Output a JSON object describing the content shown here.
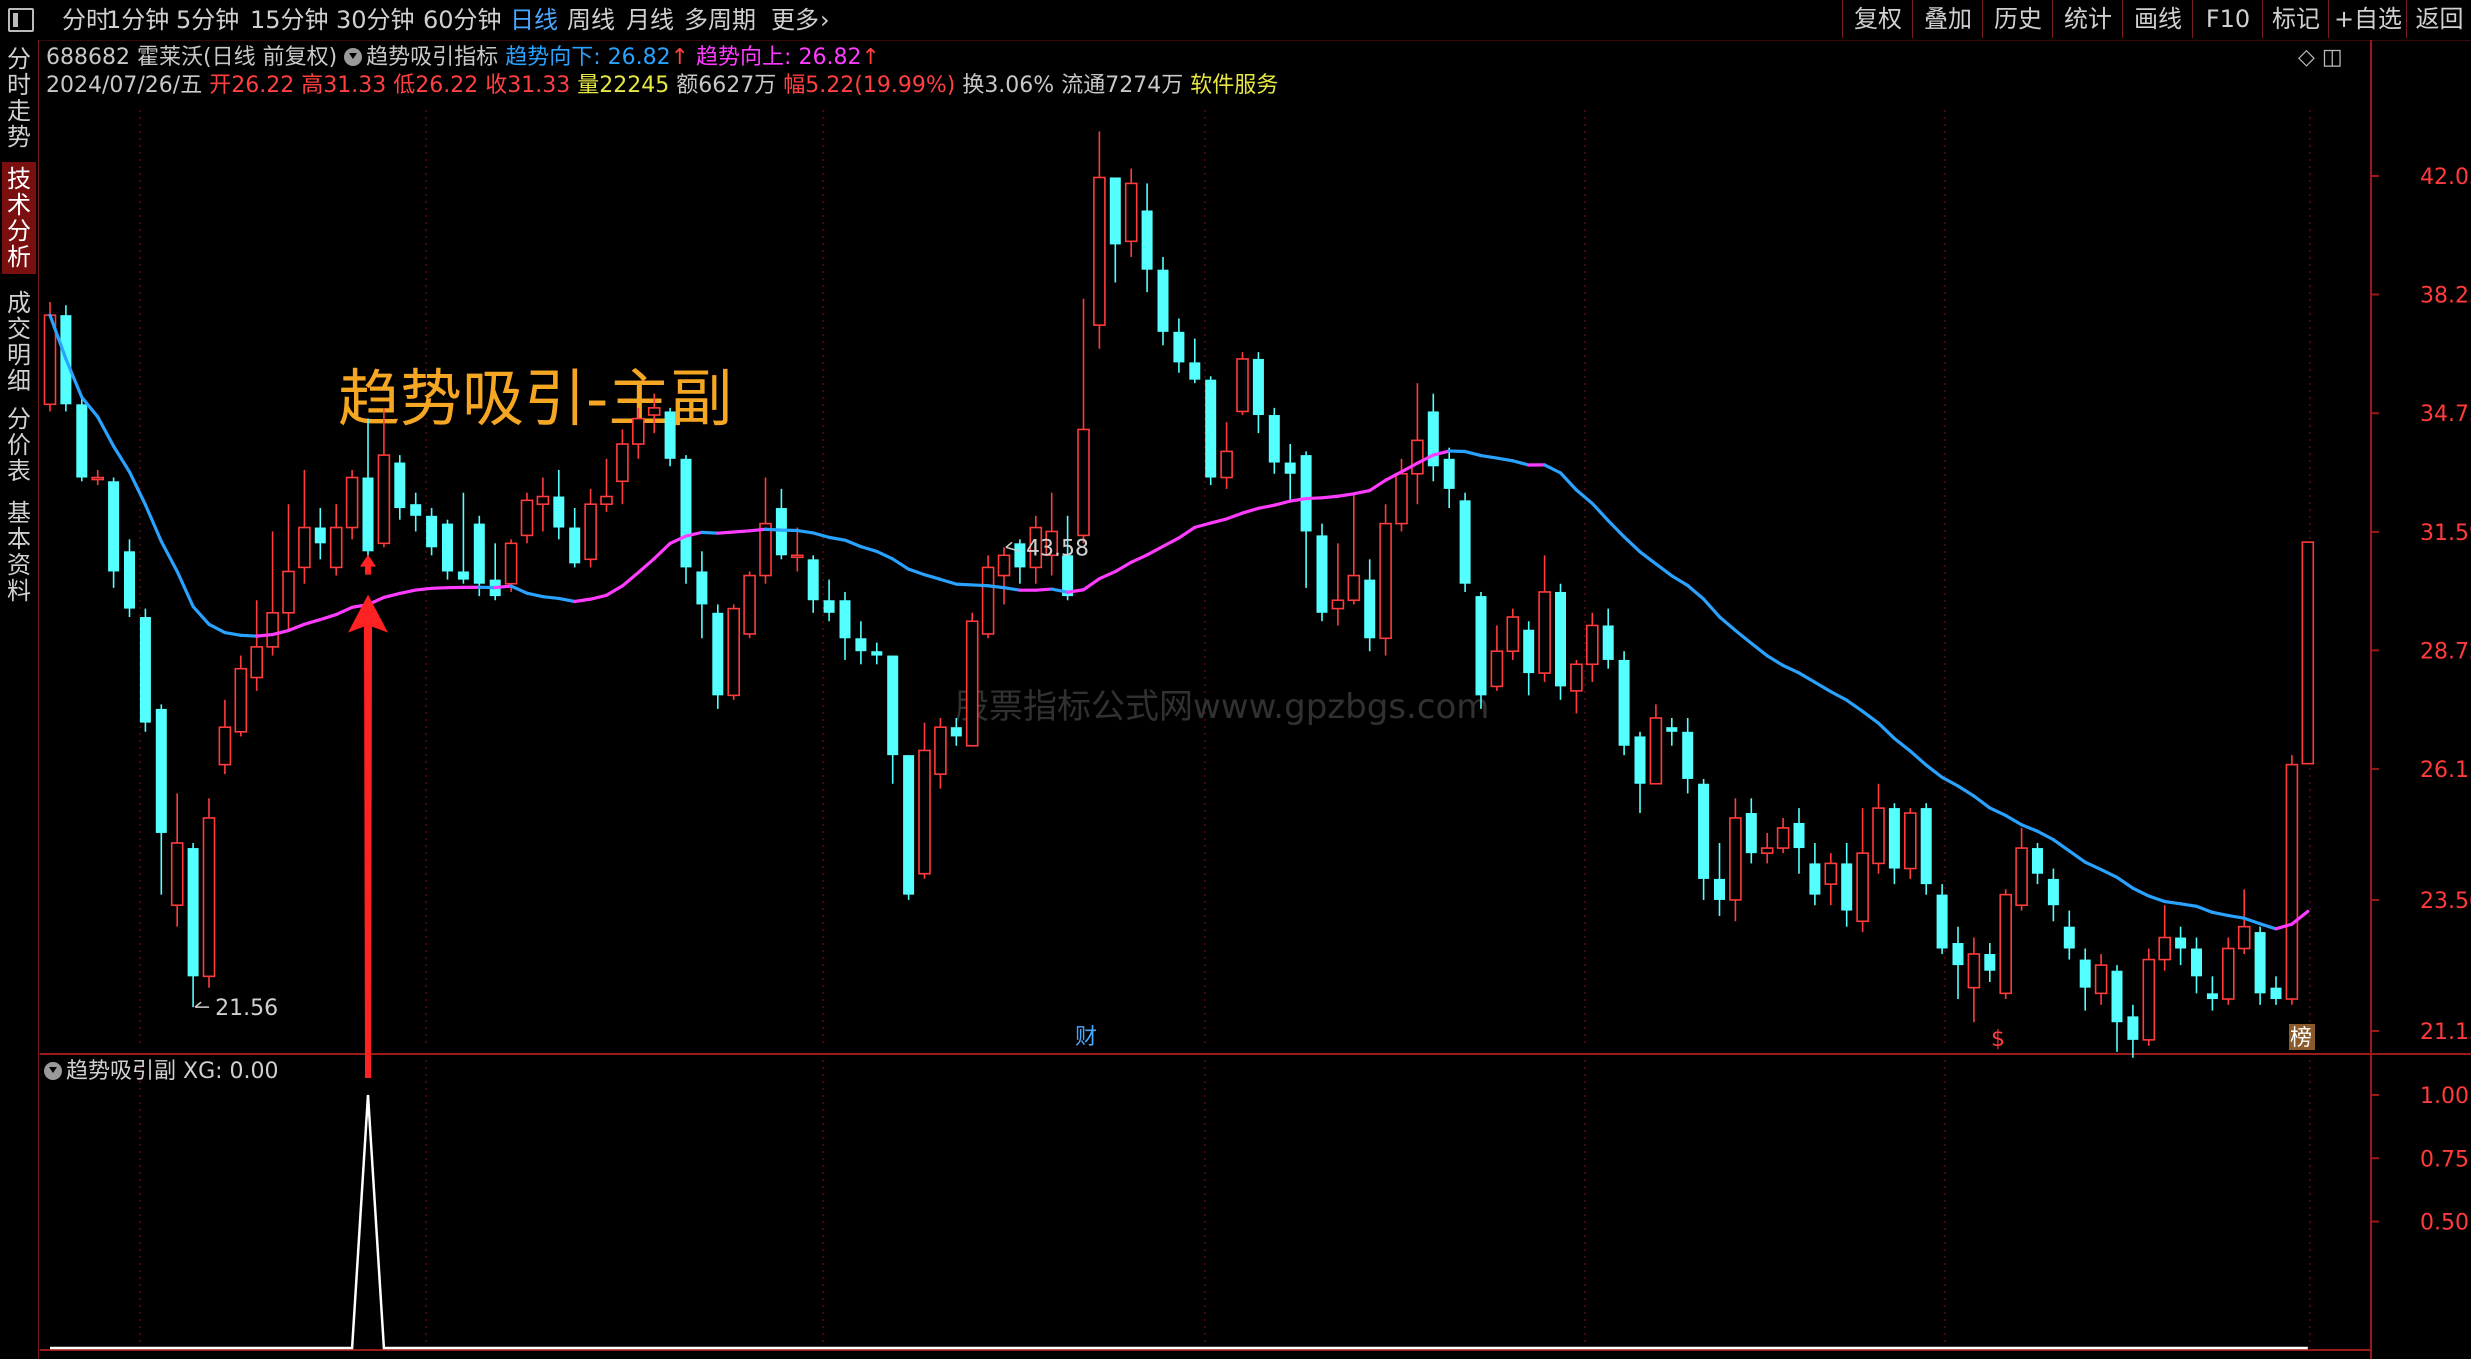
{
  "toolbar": {
    "periods": [
      "分时",
      "1分钟",
      "5分钟",
      "15分钟",
      "30分钟",
      "60分钟",
      "日线",
      "周线",
      "月线",
      "多周期",
      "更多"
    ],
    "active_period": "日线",
    "more_chevron": "chevron-right-icon",
    "right_buttons": [
      "复权",
      "叠加",
      "历史",
      "统计",
      "画线",
      "F10",
      "标记",
      "+自选",
      "返回"
    ]
  },
  "sidebar": {
    "tabs": [
      "分时走势",
      "技术分析",
      "成交明细",
      "分价表",
      "基本资料"
    ],
    "active_tab": "技术分析"
  },
  "header": {
    "code": "688682",
    "name": "霍莱沃",
    "period_note": "(日线 前复权)",
    "indicator_name": "趋势吸引指标",
    "down_label": "趋势向下:",
    "down_value": "26.82",
    "up_label": "趋势向上:",
    "up_value": "26.82",
    "arrow": "↑"
  },
  "quote": {
    "date": "2024/07/26/五",
    "open_label": "开",
    "open": "26.22",
    "high_label": "高",
    "high": "31.33",
    "low_label": "低",
    "low": "26.22",
    "close_label": "收",
    "close": "31.33",
    "vol_label": "量",
    "volume": "22245",
    "amt_label": "额",
    "amount": "6627万",
    "chg_label": "幅",
    "change": "5.22(19.99%)",
    "turnover": "换3.06%",
    "float": "流通7274万",
    "service": "软件服务"
  },
  "overlay_title": "趋势吸引-主副",
  "watermark": "股票指标公式网www.gpzbgs.com",
  "markers": {
    "fin": "财",
    "dollar": "$",
    "rank": "榜"
  },
  "sub_panel": {
    "title": "趋势吸引副",
    "value_text": "XG: 0.00"
  },
  "colors": {
    "up": "#ff3b3b",
    "down": "#54ffff",
    "trend_down": "#2aa2ff",
    "trend_up": "#ff3cff",
    "axis": "#9a1a1a",
    "grid": "#8a1010",
    "title": "#f5a623",
    "signal": "#ff2222"
  },
  "chart_data": {
    "type": "candlestick",
    "y_axis_ticks": [
      42.05,
      38.23,
      34.75,
      31.59,
      28.72,
      26.11,
      23.5,
      21.15
    ],
    "y_scale": "log",
    "annotations": [
      {
        "text": "43.58",
        "candle": 60
      },
      {
        "text": "21.56",
        "candle": 9
      }
    ],
    "candles": [
      [
        35.0,
        37.6,
        38.0,
        34.8
      ],
      [
        37.6,
        35.0,
        37.9,
        34.8
      ],
      [
        35.0,
        33.0,
        35.2,
        32.9
      ],
      [
        33.0,
        33.0,
        33.2,
        32.8
      ],
      [
        32.9,
        30.6,
        33.0,
        30.2
      ],
      [
        31.1,
        29.7,
        31.4,
        29.5
      ],
      [
        29.5,
        27.1,
        29.7,
        26.9
      ],
      [
        27.4,
        24.8,
        27.5,
        23.6
      ],
      [
        23.4,
        24.6,
        25.6,
        23.0
      ],
      [
        24.5,
        22.1,
        24.6,
        21.56
      ],
      [
        22.1,
        25.1,
        25.5,
        21.9
      ],
      [
        26.2,
        27.0,
        27.6,
        26.0
      ],
      [
        26.9,
        28.3,
        28.6,
        26.8
      ],
      [
        28.1,
        28.8,
        29.9,
        27.8
      ],
      [
        28.8,
        29.6,
        31.6,
        28.6
      ],
      [
        29.6,
        30.6,
        32.3,
        29.2
      ],
      [
        30.7,
        31.7,
        33.2,
        30.3
      ],
      [
        31.7,
        31.3,
        32.2,
        30.9
      ],
      [
        30.7,
        31.7,
        32.3,
        30.5
      ],
      [
        31.7,
        33.0,
        33.2,
        31.4
      ],
      [
        33.0,
        31.1,
        34.6,
        30.6
      ],
      [
        31.3,
        33.6,
        34.9,
        31.2
      ],
      [
        33.4,
        32.2,
        33.6,
        31.9
      ],
      [
        32.3,
        32.0,
        32.6,
        31.6
      ],
      [
        32.0,
        31.2,
        32.2,
        31.0
      ],
      [
        31.8,
        30.6,
        31.9,
        30.4
      ],
      [
        30.6,
        30.4,
        32.6,
        30.3
      ],
      [
        31.8,
        30.3,
        32.0,
        30.0
      ],
      [
        30.4,
        30.0,
        31.3,
        29.9
      ],
      [
        30.3,
        31.3,
        31.4,
        30.1
      ],
      [
        31.5,
        32.4,
        32.6,
        31.3
      ],
      [
        32.3,
        32.5,
        33.0,
        31.6
      ],
      [
        32.5,
        31.7,
        33.2,
        31.4
      ],
      [
        31.7,
        30.8,
        32.2,
        30.7
      ],
      [
        30.9,
        32.3,
        32.7,
        30.7
      ],
      [
        32.3,
        32.5,
        33.5,
        32.1
      ],
      [
        32.9,
        33.9,
        34.3,
        32.3
      ],
      [
        33.9,
        34.6,
        34.9,
        33.5
      ],
      [
        34.7,
        34.9,
        35.3,
        34.2
      ],
      [
        34.8,
        33.5,
        34.9,
        33.3
      ],
      [
        33.5,
        30.7,
        33.6,
        30.3
      ],
      [
        30.6,
        29.8,
        31.1,
        29.0
      ],
      [
        29.6,
        27.7,
        29.8,
        27.4
      ],
      [
        27.7,
        29.7,
        29.8,
        27.6
      ],
      [
        29.1,
        30.5,
        30.6,
        29.0
      ],
      [
        30.5,
        31.8,
        33.0,
        30.3
      ],
      [
        32.2,
        31.0,
        32.7,
        30.9
      ],
      [
        31.0,
        31.0,
        31.7,
        30.6
      ],
      [
        30.9,
        29.9,
        31.0,
        29.6
      ],
      [
        29.9,
        29.6,
        30.4,
        29.4
      ],
      [
        29.9,
        29.0,
        30.1,
        28.5
      ],
      [
        29.0,
        28.7,
        29.4,
        28.4
      ],
      [
        28.7,
        28.6,
        28.9,
        28.4
      ],
      [
        28.6,
        26.4,
        28.6,
        25.8
      ],
      [
        26.4,
        23.6,
        26.4,
        23.5
      ],
      [
        24.0,
        26.5,
        27.1,
        23.9
      ],
      [
        26.0,
        27.0,
        27.2,
        25.7
      ],
      [
        27.0,
        26.8,
        27.2,
        26.6
      ],
      [
        26.6,
        29.4,
        29.6,
        26.6
      ],
      [
        29.1,
        30.7,
        31.0,
        29.0
      ],
      [
        30.5,
        31.0,
        31.2,
        29.8
      ],
      [
        31.3,
        30.7,
        31.4,
        30.3
      ],
      [
        30.7,
        31.7,
        32.0,
        30.3
      ],
      [
        31.0,
        31.6,
        32.6,
        30.5
      ],
      [
        31.0,
        30.0,
        32.0,
        29.9
      ],
      [
        31.5,
        34.3,
        38.1,
        31.3
      ],
      [
        37.3,
        42.0,
        43.58,
        36.6
      ],
      [
        42.0,
        39.8,
        42.0,
        38.6
      ],
      [
        39.9,
        41.8,
        42.3,
        39.4
      ],
      [
        40.9,
        39.0,
        41.8,
        38.3
      ],
      [
        39.0,
        37.1,
        39.4,
        36.7
      ],
      [
        37.1,
        36.2,
        37.5,
        35.9
      ],
      [
        36.2,
        35.7,
        36.9,
        35.6
      ],
      [
        35.7,
        33.0,
        35.8,
        32.8
      ],
      [
        33.0,
        33.7,
        34.5,
        32.7
      ],
      [
        34.8,
        36.3,
        36.5,
        34.7
      ],
      [
        36.3,
        34.7,
        36.5,
        34.2
      ],
      [
        34.7,
        33.4,
        34.9,
        33.1
      ],
      [
        33.4,
        33.1,
        33.9,
        32.4
      ],
      [
        33.6,
        31.6,
        33.7,
        30.2
      ],
      [
        31.5,
        29.6,
        31.8,
        29.4
      ],
      [
        29.7,
        29.9,
        31.3,
        29.3
      ],
      [
        29.9,
        30.5,
        32.6,
        29.8
      ],
      [
        30.4,
        29.0,
        30.9,
        28.7
      ],
      [
        29.0,
        31.8,
        32.3,
        28.6
      ],
      [
        31.8,
        33.1,
        33.5,
        31.6
      ],
      [
        33.1,
        34.0,
        35.6,
        32.3
      ],
      [
        34.8,
        33.3,
        35.3,
        32.9
      ],
      [
        33.5,
        32.7,
        33.8,
        32.2
      ],
      [
        32.4,
        30.3,
        32.6,
        30.1
      ],
      [
        30.0,
        27.7,
        30.1,
        27.4
      ],
      [
        27.9,
        28.7,
        29.3,
        27.8
      ],
      [
        28.7,
        29.5,
        29.7,
        28.5
      ],
      [
        29.2,
        28.2,
        29.4,
        27.7
      ],
      [
        28.2,
        30.1,
        31.0,
        28.0
      ],
      [
        30.1,
        27.9,
        30.3,
        27.6
      ],
      [
        27.8,
        28.4,
        28.5,
        27.3
      ],
      [
        28.4,
        29.3,
        29.6,
        28.0
      ],
      [
        29.3,
        28.5,
        29.7,
        28.3
      ],
      [
        28.5,
        26.6,
        28.7,
        26.4
      ],
      [
        26.8,
        25.8,
        26.9,
        25.2
      ],
      [
        25.8,
        27.2,
        27.5,
        25.8
      ],
      [
        27.0,
        26.9,
        27.2,
        26.6
      ],
      [
        26.9,
        25.9,
        27.2,
        25.6
      ],
      [
        25.8,
        23.9,
        25.9,
        23.5
      ],
      [
        23.9,
        23.5,
        24.6,
        23.2
      ],
      [
        23.5,
        25.1,
        25.5,
        23.1
      ],
      [
        25.2,
        24.4,
        25.5,
        24.2
      ],
      [
        24.4,
        24.5,
        24.8,
        24.2
      ],
      [
        24.5,
        24.9,
        25.1,
        24.4
      ],
      [
        25.0,
        24.5,
        25.3,
        24.0
      ],
      [
        24.2,
        23.6,
        24.6,
        23.4
      ],
      [
        23.8,
        24.2,
        24.4,
        23.4
      ],
      [
        24.2,
        23.3,
        24.6,
        23.0
      ],
      [
        23.1,
        24.4,
        25.3,
        22.9
      ],
      [
        24.2,
        25.3,
        25.8,
        24.0
      ],
      [
        25.3,
        24.1,
        25.4,
        23.8
      ],
      [
        24.1,
        25.2,
        25.3,
        23.9
      ],
      [
        25.3,
        23.8,
        25.4,
        23.6
      ],
      [
        23.6,
        22.6,
        23.8,
        22.5
      ],
      [
        22.7,
        22.3,
        23.0,
        21.7
      ],
      [
        21.9,
        22.5,
        22.8,
        21.3
      ],
      [
        22.5,
        22.2,
        22.7,
        22.0
      ],
      [
        21.8,
        23.6,
        23.7,
        21.7
      ],
      [
        23.4,
        24.5,
        24.9,
        23.3
      ],
      [
        24.5,
        24.0,
        24.6,
        23.8
      ],
      [
        23.9,
        23.4,
        24.1,
        23.1
      ],
      [
        23.0,
        22.6,
        23.3,
        22.4
      ],
      [
        22.4,
        21.9,
        22.6,
        21.5
      ],
      [
        21.8,
        22.3,
        22.5,
        21.6
      ],
      [
        22.2,
        21.3,
        22.3,
        20.8
      ],
      [
        21.4,
        21.0,
        21.6,
        20.7
      ],
      [
        21.0,
        22.4,
        22.6,
        20.9
      ],
      [
        22.4,
        22.8,
        23.4,
        22.2
      ],
      [
        22.8,
        22.6,
        23.0,
        22.3
      ],
      [
        22.6,
        22.1,
        22.8,
        21.8
      ],
      [
        21.8,
        21.7,
        22.1,
        21.5
      ],
      [
        21.7,
        22.6,
        22.8,
        21.6
      ],
      [
        22.6,
        23.0,
        23.7,
        22.5
      ],
      [
        22.9,
        21.8,
        23.0,
        21.6
      ],
      [
        21.9,
        21.7,
        22.1,
        21.6
      ],
      [
        21.7,
        26.2,
        26.4,
        21.6
      ],
      [
        26.22,
        31.33,
        31.33,
        26.22
      ]
    ]
  }
}
